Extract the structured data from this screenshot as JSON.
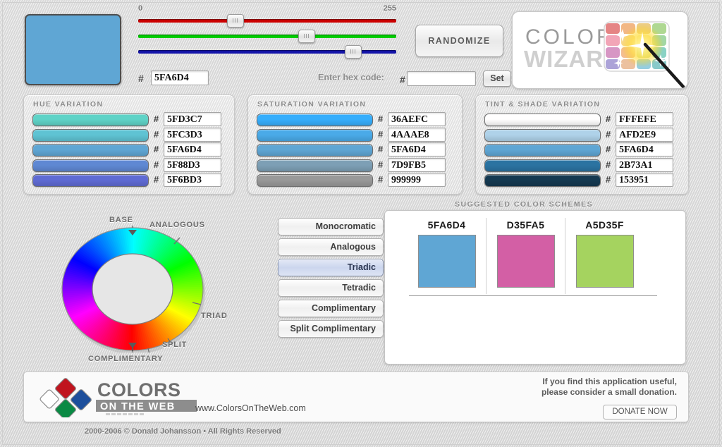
{
  "app": {
    "brand_line1": "COLOR",
    "brand_line2": "WIZARD"
  },
  "current_color": {
    "hex": "5FA6D4",
    "hash": "#",
    "rgb": [
      95,
      166,
      212
    ],
    "swatch_color": "#5FA6D4"
  },
  "sliders": {
    "min_label": "0",
    "max_label": "255",
    "channels": [
      {
        "name": "red",
        "value": 95,
        "percent": 37.3,
        "track_color": "#cc0000"
      },
      {
        "name": "green",
        "value": 166,
        "percent": 65.1,
        "track_color": "#00cc00"
      },
      {
        "name": "blue",
        "value": 212,
        "percent": 83.1,
        "track_color": "#1414aa"
      }
    ]
  },
  "hex_entry": {
    "label": "Enter hex code:",
    "hash": "#",
    "value": "",
    "placeholder": "",
    "set_label": "Set"
  },
  "randomize_label": "RANDOMIZE",
  "hue_variation": {
    "title": "HUE VARIATION",
    "rows": [
      {
        "hex": "5FD3C7",
        "color": "#5FD3C7"
      },
      {
        "hex": "5FC3D3",
        "color": "#5FC3D3"
      },
      {
        "hex": "5FA6D4",
        "color": "#5FA6D4"
      },
      {
        "hex": "5F88D3",
        "color": "#5F88D3"
      },
      {
        "hex": "5F6BD3",
        "color": "#5F6BD3"
      }
    ]
  },
  "saturation_variation": {
    "title": "SATURATION VARIATION",
    "rows": [
      {
        "hex": "36AEFC",
        "color": "#36AEFC"
      },
      {
        "hex": "4AAAE8",
        "color": "#4AAAE8"
      },
      {
        "hex": "5FA6D4",
        "color": "#5FA6D4"
      },
      {
        "hex": "7D9FB5",
        "color": "#7D9FB5"
      },
      {
        "hex": "999999",
        "color": "#999999"
      }
    ]
  },
  "tint_shade_variation": {
    "title": "TINT & SHADE VARIATION",
    "rows": [
      {
        "hex": "FFFEFE",
        "color": "#FFFEFE"
      },
      {
        "hex": "AFD2E9",
        "color": "#AFD2E9"
      },
      {
        "hex": "5FA6D4",
        "color": "#5FA6D4"
      },
      {
        "hex": "2B73A1",
        "color": "#2B73A1"
      },
      {
        "hex": "153951",
        "color": "#153951"
      }
    ]
  },
  "color_wheel": {
    "labels": {
      "base": "BASE",
      "analogous": "ANALOGOUS",
      "triad": "TRIAD",
      "split": "SPLIT",
      "complimentary": "COMPLIMENTARY"
    }
  },
  "scheme_buttons": [
    {
      "label": "Monocromatic",
      "active": false
    },
    {
      "label": "Analogous",
      "active": false
    },
    {
      "label": "Triadic",
      "active": true
    },
    {
      "label": "Tetradic",
      "active": false
    },
    {
      "label": "Complimentary",
      "active": false
    },
    {
      "label": "Split Complimentary",
      "active": false
    }
  ],
  "suggested": {
    "title": "SUGGESTED COLOR SCHEMES",
    "colors": [
      {
        "hex": "5FA6D4",
        "color": "#5FA6D4"
      },
      {
        "hex": "D35FA5",
        "color": "#D35FA5"
      },
      {
        "hex": "A5D35F",
        "color": "#A5D35F"
      }
    ]
  },
  "footer": {
    "logo_line1": "COLORS",
    "logo_line2": "ON THE WEB",
    "url": "www.ColorsOnTheWeb.com",
    "donate_line1": "If you find this application useful,",
    "donate_line2": "please consider a small donation.",
    "donate_button": "DONATE NOW",
    "copyright": "2000-2006 © Donald Johansson • All Rights Reserved"
  }
}
